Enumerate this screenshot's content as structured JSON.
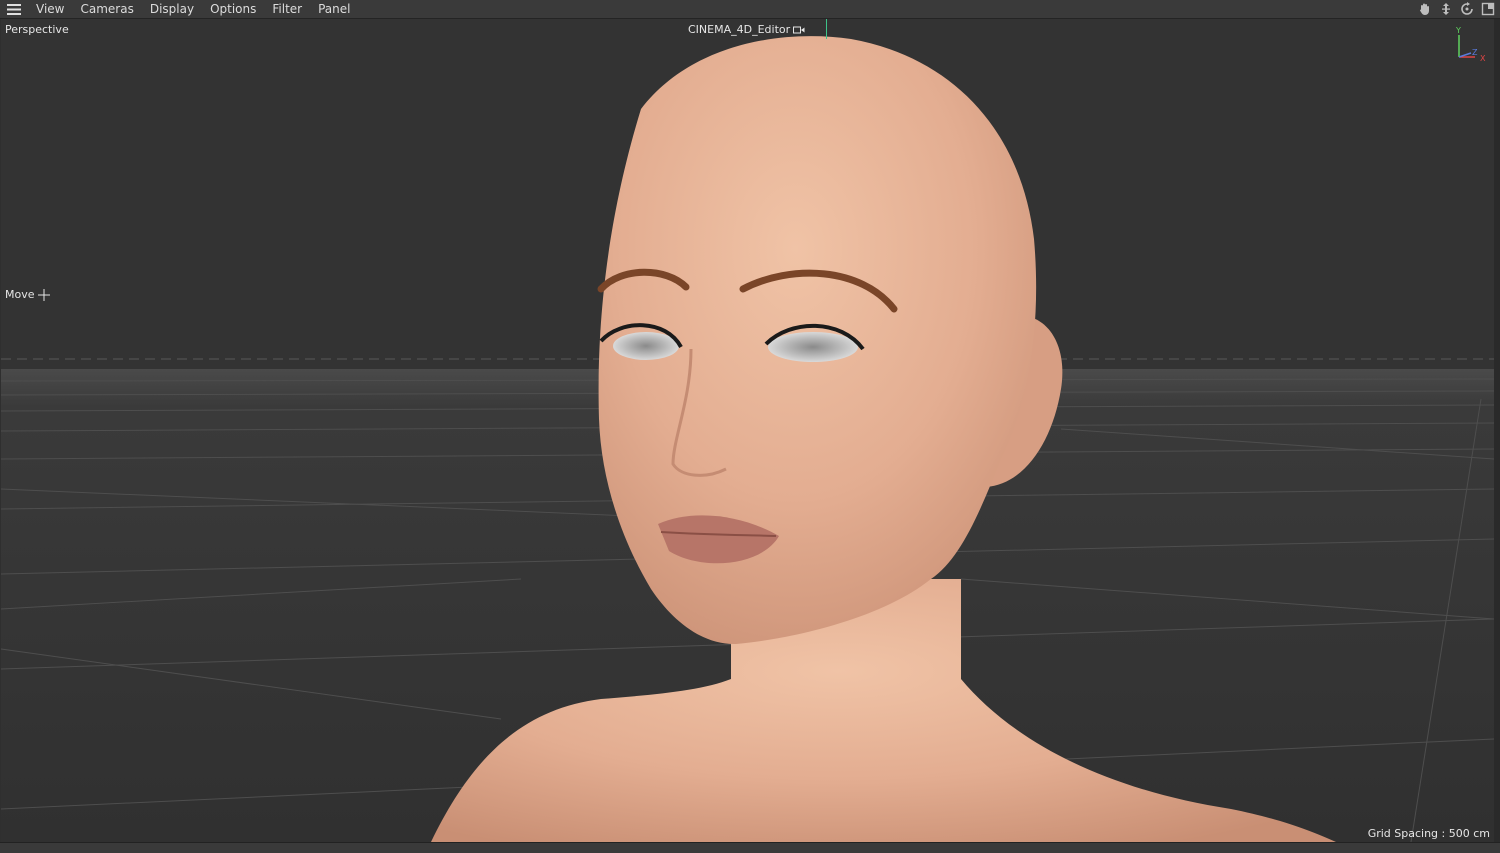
{
  "menu": {
    "items": [
      {
        "label": "View"
      },
      {
        "label": "Cameras"
      },
      {
        "label": "Display"
      },
      {
        "label": "Options"
      },
      {
        "label": "Filter"
      },
      {
        "label": "Panel"
      }
    ]
  },
  "nav_icons": [
    "hand-pan-icon",
    "move-vertical-icon",
    "rotate-icon",
    "maximize-icon"
  ],
  "viewport": {
    "view_name": "Perspective",
    "camera_name": "CINEMA_4D_Editor",
    "tool_label": "Move",
    "grid_spacing": "Grid Spacing : 500 cm",
    "axis": {
      "y": "Y",
      "z": "Z",
      "x": "X"
    }
  },
  "colors": {
    "background": "#333333",
    "skin": "#e2ad92",
    "axis_y": "#5fd35f",
    "axis_z": "#5a7bdc",
    "axis_x": "#e04545"
  }
}
